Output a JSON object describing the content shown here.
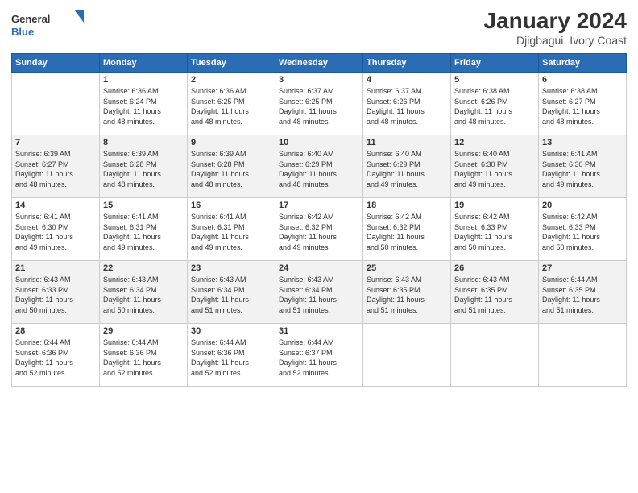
{
  "header": {
    "logo_general": "General",
    "logo_blue": "Blue",
    "month_year": "January 2024",
    "location": "Djigbagui, Ivory Coast"
  },
  "weekdays": [
    "Sunday",
    "Monday",
    "Tuesday",
    "Wednesday",
    "Thursday",
    "Friday",
    "Saturday"
  ],
  "weeks": [
    [
      {
        "day": "",
        "sunrise": "",
        "sunset": "",
        "daylight": ""
      },
      {
        "day": "1",
        "sunrise": "Sunrise: 6:36 AM",
        "sunset": "Sunset: 6:24 PM",
        "daylight": "Daylight: 11 hours and 48 minutes."
      },
      {
        "day": "2",
        "sunrise": "Sunrise: 6:36 AM",
        "sunset": "Sunset: 6:25 PM",
        "daylight": "Daylight: 11 hours and 48 minutes."
      },
      {
        "day": "3",
        "sunrise": "Sunrise: 6:37 AM",
        "sunset": "Sunset: 6:25 PM",
        "daylight": "Daylight: 11 hours and 48 minutes."
      },
      {
        "day": "4",
        "sunrise": "Sunrise: 6:37 AM",
        "sunset": "Sunset: 6:26 PM",
        "daylight": "Daylight: 11 hours and 48 minutes."
      },
      {
        "day": "5",
        "sunrise": "Sunrise: 6:38 AM",
        "sunset": "Sunset: 6:26 PM",
        "daylight": "Daylight: 11 hours and 48 minutes."
      },
      {
        "day": "6",
        "sunrise": "Sunrise: 6:38 AM",
        "sunset": "Sunset: 6:27 PM",
        "daylight": "Daylight: 11 hours and 48 minutes."
      }
    ],
    [
      {
        "day": "7",
        "sunrise": "Sunrise: 6:39 AM",
        "sunset": "Sunset: 6:27 PM",
        "daylight": "Daylight: 11 hours and 48 minutes."
      },
      {
        "day": "8",
        "sunrise": "Sunrise: 6:39 AM",
        "sunset": "Sunset: 6:28 PM",
        "daylight": "Daylight: 11 hours and 48 minutes."
      },
      {
        "day": "9",
        "sunrise": "Sunrise: 6:39 AM",
        "sunset": "Sunset: 6:28 PM",
        "daylight": "Daylight: 11 hours and 48 minutes."
      },
      {
        "day": "10",
        "sunrise": "Sunrise: 6:40 AM",
        "sunset": "Sunset: 6:29 PM",
        "daylight": "Daylight: 11 hours and 48 minutes."
      },
      {
        "day": "11",
        "sunrise": "Sunrise: 6:40 AM",
        "sunset": "Sunset: 6:29 PM",
        "daylight": "Daylight: 11 hours and 49 minutes."
      },
      {
        "day": "12",
        "sunrise": "Sunrise: 6:40 AM",
        "sunset": "Sunset: 6:30 PM",
        "daylight": "Daylight: 11 hours and 49 minutes."
      },
      {
        "day": "13",
        "sunrise": "Sunrise: 6:41 AM",
        "sunset": "Sunset: 6:30 PM",
        "daylight": "Daylight: 11 hours and 49 minutes."
      }
    ],
    [
      {
        "day": "14",
        "sunrise": "Sunrise: 6:41 AM",
        "sunset": "Sunset: 6:30 PM",
        "daylight": "Daylight: 11 hours and 49 minutes."
      },
      {
        "day": "15",
        "sunrise": "Sunrise: 6:41 AM",
        "sunset": "Sunset: 6:31 PM",
        "daylight": "Daylight: 11 hours and 49 minutes."
      },
      {
        "day": "16",
        "sunrise": "Sunrise: 6:41 AM",
        "sunset": "Sunset: 6:31 PM",
        "daylight": "Daylight: 11 hours and 49 minutes."
      },
      {
        "day": "17",
        "sunrise": "Sunrise: 6:42 AM",
        "sunset": "Sunset: 6:32 PM",
        "daylight": "Daylight: 11 hours and 49 minutes."
      },
      {
        "day": "18",
        "sunrise": "Sunrise: 6:42 AM",
        "sunset": "Sunset: 6:32 PM",
        "daylight": "Daylight: 11 hours and 50 minutes."
      },
      {
        "day": "19",
        "sunrise": "Sunrise: 6:42 AM",
        "sunset": "Sunset: 6:33 PM",
        "daylight": "Daylight: 11 hours and 50 minutes."
      },
      {
        "day": "20",
        "sunrise": "Sunrise: 6:42 AM",
        "sunset": "Sunset: 6:33 PM",
        "daylight": "Daylight: 11 hours and 50 minutes."
      }
    ],
    [
      {
        "day": "21",
        "sunrise": "Sunrise: 6:43 AM",
        "sunset": "Sunset: 6:33 PM",
        "daylight": "Daylight: 11 hours and 50 minutes."
      },
      {
        "day": "22",
        "sunrise": "Sunrise: 6:43 AM",
        "sunset": "Sunset: 6:34 PM",
        "daylight": "Daylight: 11 hours and 50 minutes."
      },
      {
        "day": "23",
        "sunrise": "Sunrise: 6:43 AM",
        "sunset": "Sunset: 6:34 PM",
        "daylight": "Daylight: 11 hours and 51 minutes."
      },
      {
        "day": "24",
        "sunrise": "Sunrise: 6:43 AM",
        "sunset": "Sunset: 6:34 PM",
        "daylight": "Daylight: 11 hours and 51 minutes."
      },
      {
        "day": "25",
        "sunrise": "Sunrise: 6:43 AM",
        "sunset": "Sunset: 6:35 PM",
        "daylight": "Daylight: 11 hours and 51 minutes."
      },
      {
        "day": "26",
        "sunrise": "Sunrise: 6:43 AM",
        "sunset": "Sunset: 6:35 PM",
        "daylight": "Daylight: 11 hours and 51 minutes."
      },
      {
        "day": "27",
        "sunrise": "Sunrise: 6:44 AM",
        "sunset": "Sunset: 6:35 PM",
        "daylight": "Daylight: 11 hours and 51 minutes."
      }
    ],
    [
      {
        "day": "28",
        "sunrise": "Sunrise: 6:44 AM",
        "sunset": "Sunset: 6:36 PM",
        "daylight": "Daylight: 11 hours and 52 minutes."
      },
      {
        "day": "29",
        "sunrise": "Sunrise: 6:44 AM",
        "sunset": "Sunset: 6:36 PM",
        "daylight": "Daylight: 11 hours and 52 minutes."
      },
      {
        "day": "30",
        "sunrise": "Sunrise: 6:44 AM",
        "sunset": "Sunset: 6:36 PM",
        "daylight": "Daylight: 11 hours and 52 minutes."
      },
      {
        "day": "31",
        "sunrise": "Sunrise: 6:44 AM",
        "sunset": "Sunset: 6:37 PM",
        "daylight": "Daylight: 11 hours and 52 minutes."
      },
      {
        "day": "",
        "sunrise": "",
        "sunset": "",
        "daylight": ""
      },
      {
        "day": "",
        "sunrise": "",
        "sunset": "",
        "daylight": ""
      },
      {
        "day": "",
        "sunrise": "",
        "sunset": "",
        "daylight": ""
      }
    ]
  ]
}
